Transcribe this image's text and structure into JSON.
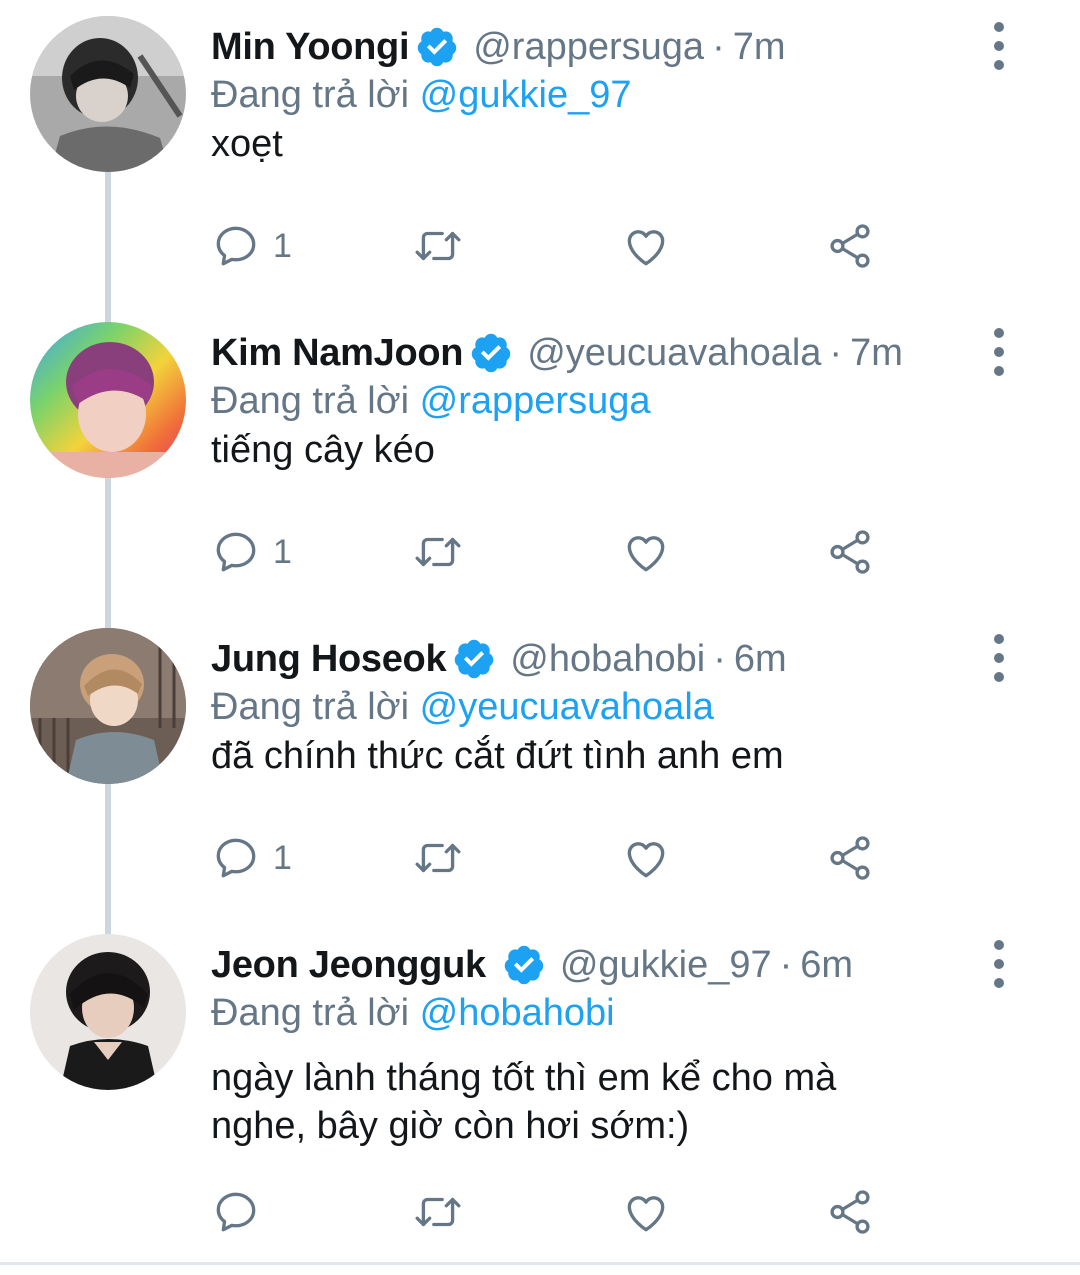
{
  "tweets": [
    {
      "name": "Min Yoongi",
      "handle": "@rappersuga",
      "time": "7m",
      "replying_prefix": "Đang trả lời",
      "replying_to": "@gukkie_97",
      "body": "xoẹt",
      "reply_count": "1",
      "avatar_icon": "avatar-min-yoongi"
    },
    {
      "name": "Kim NamJoon",
      "handle": "@yeucuavahoala",
      "time": "7m",
      "replying_prefix": "Đang trả lời",
      "replying_to": "@rappersuga",
      "body": "tiếng cây kéo",
      "reply_count": "1",
      "avatar_icon": "avatar-kim-namjoon"
    },
    {
      "name": "Jung Hoseok",
      "handle": "@hobahobi",
      "time": "6m",
      "replying_prefix": "Đang trả lời",
      "replying_to": "@yeucuavahoala",
      "body": "đã chính thức cắt đứt tình anh em",
      "reply_count": "1",
      "avatar_icon": "avatar-jung-hoseok"
    },
    {
      "name": "Jeon Jeongguk",
      "handle": "@gukkie_97",
      "time": "6m",
      "replying_prefix": "Đang trả lời",
      "replying_to": "@hobahobi",
      "body_line1": "ngày lành tháng tốt thì em kể cho mà",
      "body_line2": "nghe, bây giờ còn hơi sớm:)",
      "reply_count": "",
      "avatar_icon": "avatar-jeon-jeongguk"
    }
  ],
  "separator": "·",
  "colors": {
    "accent": "#1da1f2",
    "secondary_text": "#657786",
    "primary_text": "#14171a",
    "thread_line": "#ccd6dd"
  },
  "icons": [
    "verified-badge-icon",
    "more-vertical-icon",
    "reply-icon",
    "retweet-icon",
    "like-icon",
    "share-icon"
  ]
}
